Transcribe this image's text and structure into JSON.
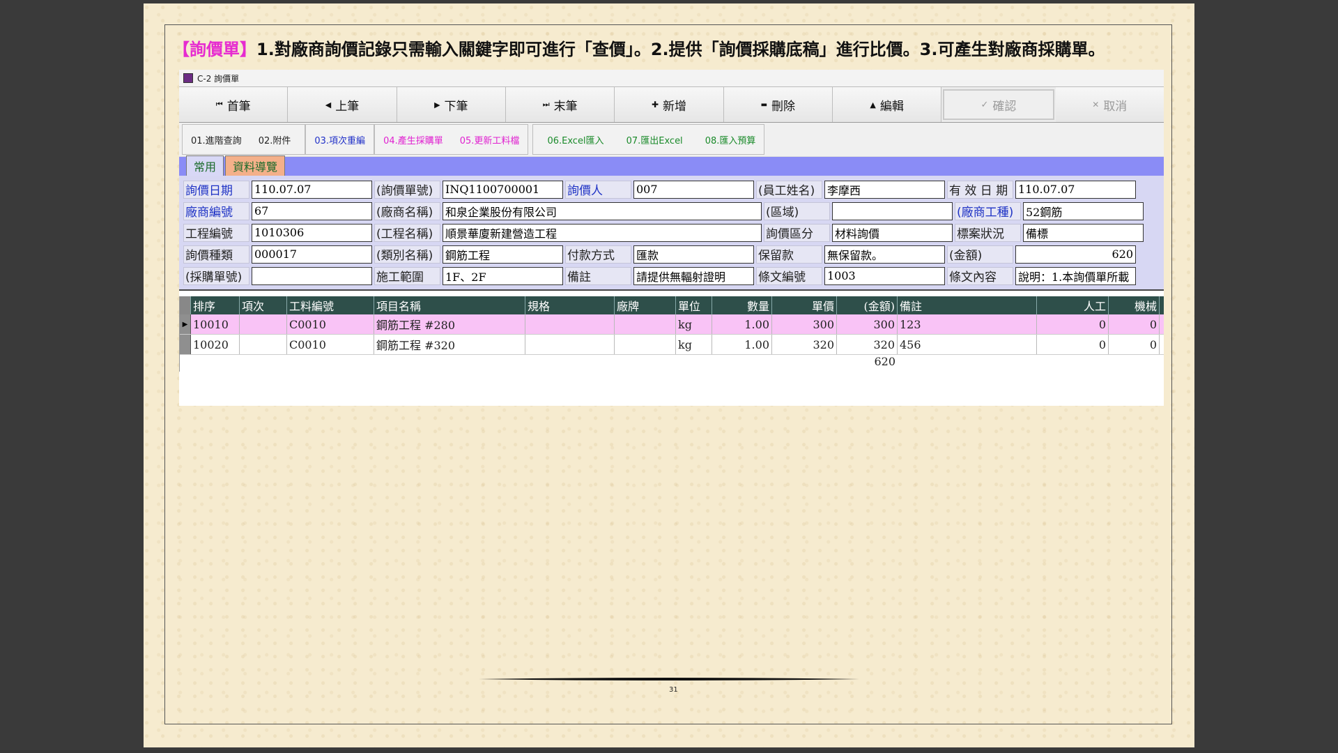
{
  "headline": {
    "tag": "【詢價單】",
    "text": "1.對廠商詢價記錄只需輸入關鍵字即可進行「查價」。2.提供「詢價採購底稿」進行比價。3.可產生對廠商採購單。"
  },
  "window": {
    "title": "C-2 詢價單"
  },
  "nav": [
    {
      "icon": "⏮",
      "label": "首筆"
    },
    {
      "icon": "◀",
      "label": "上筆"
    },
    {
      "icon": "▶",
      "label": "下筆"
    },
    {
      "icon": "⏭",
      "label": "末筆"
    },
    {
      "icon": "✚",
      "label": "新增"
    },
    {
      "icon": "▬",
      "label": "刪除"
    },
    {
      "icon": "▲",
      "label": "編輯"
    },
    {
      "icon": "✓",
      "label": "確認"
    },
    {
      "icon": "✕",
      "label": "取消"
    }
  ],
  "tools": [
    {
      "label": "01.進階查詢",
      "color": "#222222"
    },
    {
      "label": "02.附件",
      "color": "#222222"
    },
    {
      "label": "03.項次重編",
      "color": "#2030c8"
    },
    {
      "label": "04.產生採購單",
      "color": "#e020d0"
    },
    {
      "label": "05.更新工料檔",
      "color": "#e020d0"
    },
    {
      "label": "06.Excel匯入",
      "color": "#1a8a2a"
    },
    {
      "label": "07.匯出Excel",
      "color": "#1a8a2a"
    },
    {
      "label": "08.匯入預算",
      "color": "#1a8a2a"
    }
  ],
  "tabs": [
    "常用",
    "資料導覽"
  ],
  "form": {
    "inquiry_date_label": "詢價日期",
    "inquiry_date": "110.07.07",
    "inquiry_no_label": "(詢價單號)",
    "inquiry_no": "INQ1100700001",
    "inquirer_label": "詢價人",
    "inquirer": "007",
    "emp_name_label": "(員工姓名)",
    "emp_name": "李摩西",
    "valid_date_label": "有 效 日 期",
    "valid_date": "110.07.07",
    "vendor_no_label": "廠商編號",
    "vendor_no": "67",
    "vendor_name_label": "(廠商名稱)",
    "vendor_name": "和泉企業股份有限公司",
    "area_label": "(區域)",
    "area": "",
    "vendor_type_label": "(廠商工種)",
    "vendor_type": "52鋼筋",
    "project_no_label": "工程編號",
    "project_no": "1010306",
    "project_name_label": "(工程名稱)",
    "project_name": "順景華廈新建營造工程",
    "inquiry_cat_label": "詢價區分",
    "inquiry_cat": "材料詢價",
    "bid_status_label": "標案狀況",
    "bid_status": "備標",
    "inquiry_type_label": "詢價種類",
    "inquiry_type": "000017",
    "category_name_label": "(類別名稱)",
    "category_name": "鋼筋工程",
    "payment_label": "付款方式",
    "payment": "匯款",
    "retention_label": "保留款",
    "retention": "無保留款。",
    "amount_label": "(金額)",
    "amount": "620",
    "po_no_label": "(採購單號)",
    "po_no": "",
    "scope_label": "施工範圍",
    "scope": "1F、2F",
    "note_label": "備註",
    "note": "請提供無輻射證明",
    "clause_no_label": "條文編號",
    "clause_no": "1003",
    "clause_text_label": "條文內容",
    "clause_text": "說明：1.本詢價單所載"
  },
  "grid": {
    "headers": [
      "排序",
      "項次",
      "工料編號",
      "項目名稱",
      "規格",
      "廠牌",
      "單位",
      "數量",
      "單價",
      "(金額)",
      "備註",
      "人工",
      "機械"
    ],
    "rows": [
      [
        "10010",
        "",
        "C0010",
        "鋼筋工程 #280",
        "",
        "",
        "kg",
        "1.00",
        "300",
        "300",
        "123",
        "0",
        "0"
      ],
      [
        "10020",
        "",
        "C0010",
        "鋼筋工程 #320",
        "",
        "",
        "kg",
        "1.00",
        "320",
        "320",
        "456",
        "0",
        "0"
      ]
    ],
    "total": "620"
  },
  "page_number": "31"
}
